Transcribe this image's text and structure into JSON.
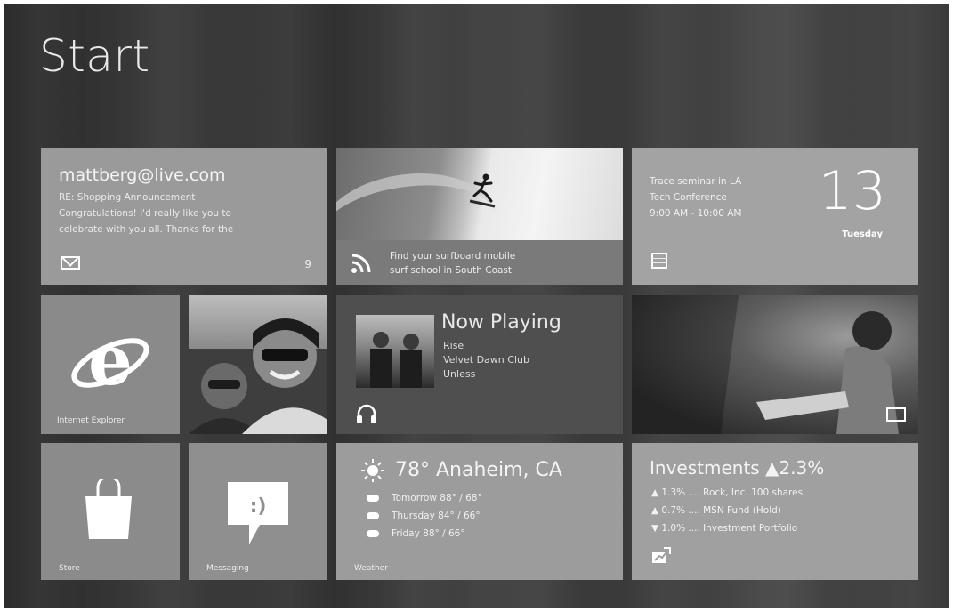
{
  "start": {
    "title": "Start"
  },
  "mail": {
    "address": "mattberg@live.com",
    "lines": [
      "RE: Shopping Announcement",
      "Congratulations! I'd really like you to",
      "celebrate with you all. Thanks for the"
    ],
    "count": "9"
  },
  "news": {
    "lines": [
      "Find your surfboard mobile",
      "surf school in South Coast"
    ]
  },
  "calendar": {
    "lines": [
      "Trace seminar in LA",
      "Tech Conference",
      "9:00 AM - 10:00 AM"
    ],
    "date_number": "13",
    "day": "Tuesday"
  },
  "ie": {
    "label": "Internet Explorer"
  },
  "music": {
    "title": "Now Playing",
    "lines": [
      "Rise",
      "Velvet Dawn Club",
      "Unless"
    ]
  },
  "store": {
    "label": "Store"
  },
  "messaging": {
    "label": "Messaging"
  },
  "weather": {
    "title": "78° Anaheim, CA",
    "forecast": [
      "Tomorrow  88° / 68°",
      "Thursday  84° / 66°",
      "Friday  88° / 66°"
    ],
    "label": "Weather"
  },
  "investments": {
    "title": "Investments ▲2.3%",
    "rows": [
      "▲ 1.3%  ....  Rock, Inc. 100 shares",
      "▲ 0.7%  ....  MSN Fund (Hold)",
      "▼ 1.0%  ....  Investment Portfolio"
    ]
  },
  "colors": {
    "background": "#3a3a3a",
    "tile_light": "#a0a0a0",
    "text": "#f4f4f4"
  },
  "icons": [
    "mail-icon",
    "rss-icon",
    "calendar-icon",
    "ie-icon",
    "headphones-icon",
    "photo-icon",
    "store-icon",
    "messaging-icon",
    "sun-icon",
    "investments-icon"
  ]
}
